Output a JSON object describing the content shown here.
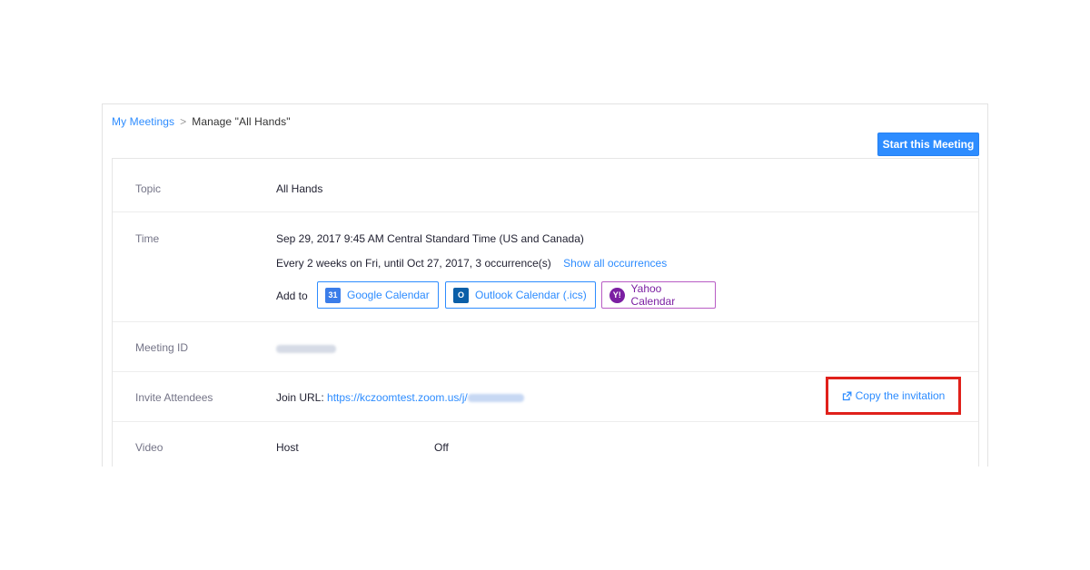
{
  "breadcrumb": {
    "parent": "My Meetings",
    "separator": ">",
    "current": "Manage \"All Hands\""
  },
  "start_button": "Start this Meeting",
  "rows": {
    "topic": {
      "label": "Topic",
      "value": "All Hands"
    },
    "time": {
      "label": "Time",
      "line1": "Sep 29, 2017 9:45 AM Central Standard Time (US and Canada)",
      "line2": "Every 2 weeks on Fri, until Oct 27, 2017, 3 occurrence(s)",
      "show_all": "Show all occurrences",
      "add_to": "Add to",
      "calendars": {
        "google": {
          "label": "Google Calendar",
          "icon": "google-calendar-icon",
          "glyph": "31"
        },
        "outlook": {
          "label": "Outlook Calendar (.ics)",
          "icon": "outlook-icon",
          "glyph": "O"
        },
        "yahoo": {
          "label": "Yahoo Calendar",
          "icon": "yahoo-icon",
          "glyph": "Y!"
        }
      }
    },
    "meeting_id": {
      "label": "Meeting ID"
    },
    "invite": {
      "label": "Invite Attendees",
      "join_label": "Join URL:",
      "join_url": "https://kczoomtest.zoom.us/j/",
      "copy_label": "Copy the invitation"
    },
    "video": {
      "label": "Video",
      "host": "Host",
      "host_value": "Off"
    }
  },
  "colors": {
    "accent": "#2d8cff",
    "highlight_box": "#e0211b",
    "yahoo": "#7b1fa2"
  }
}
